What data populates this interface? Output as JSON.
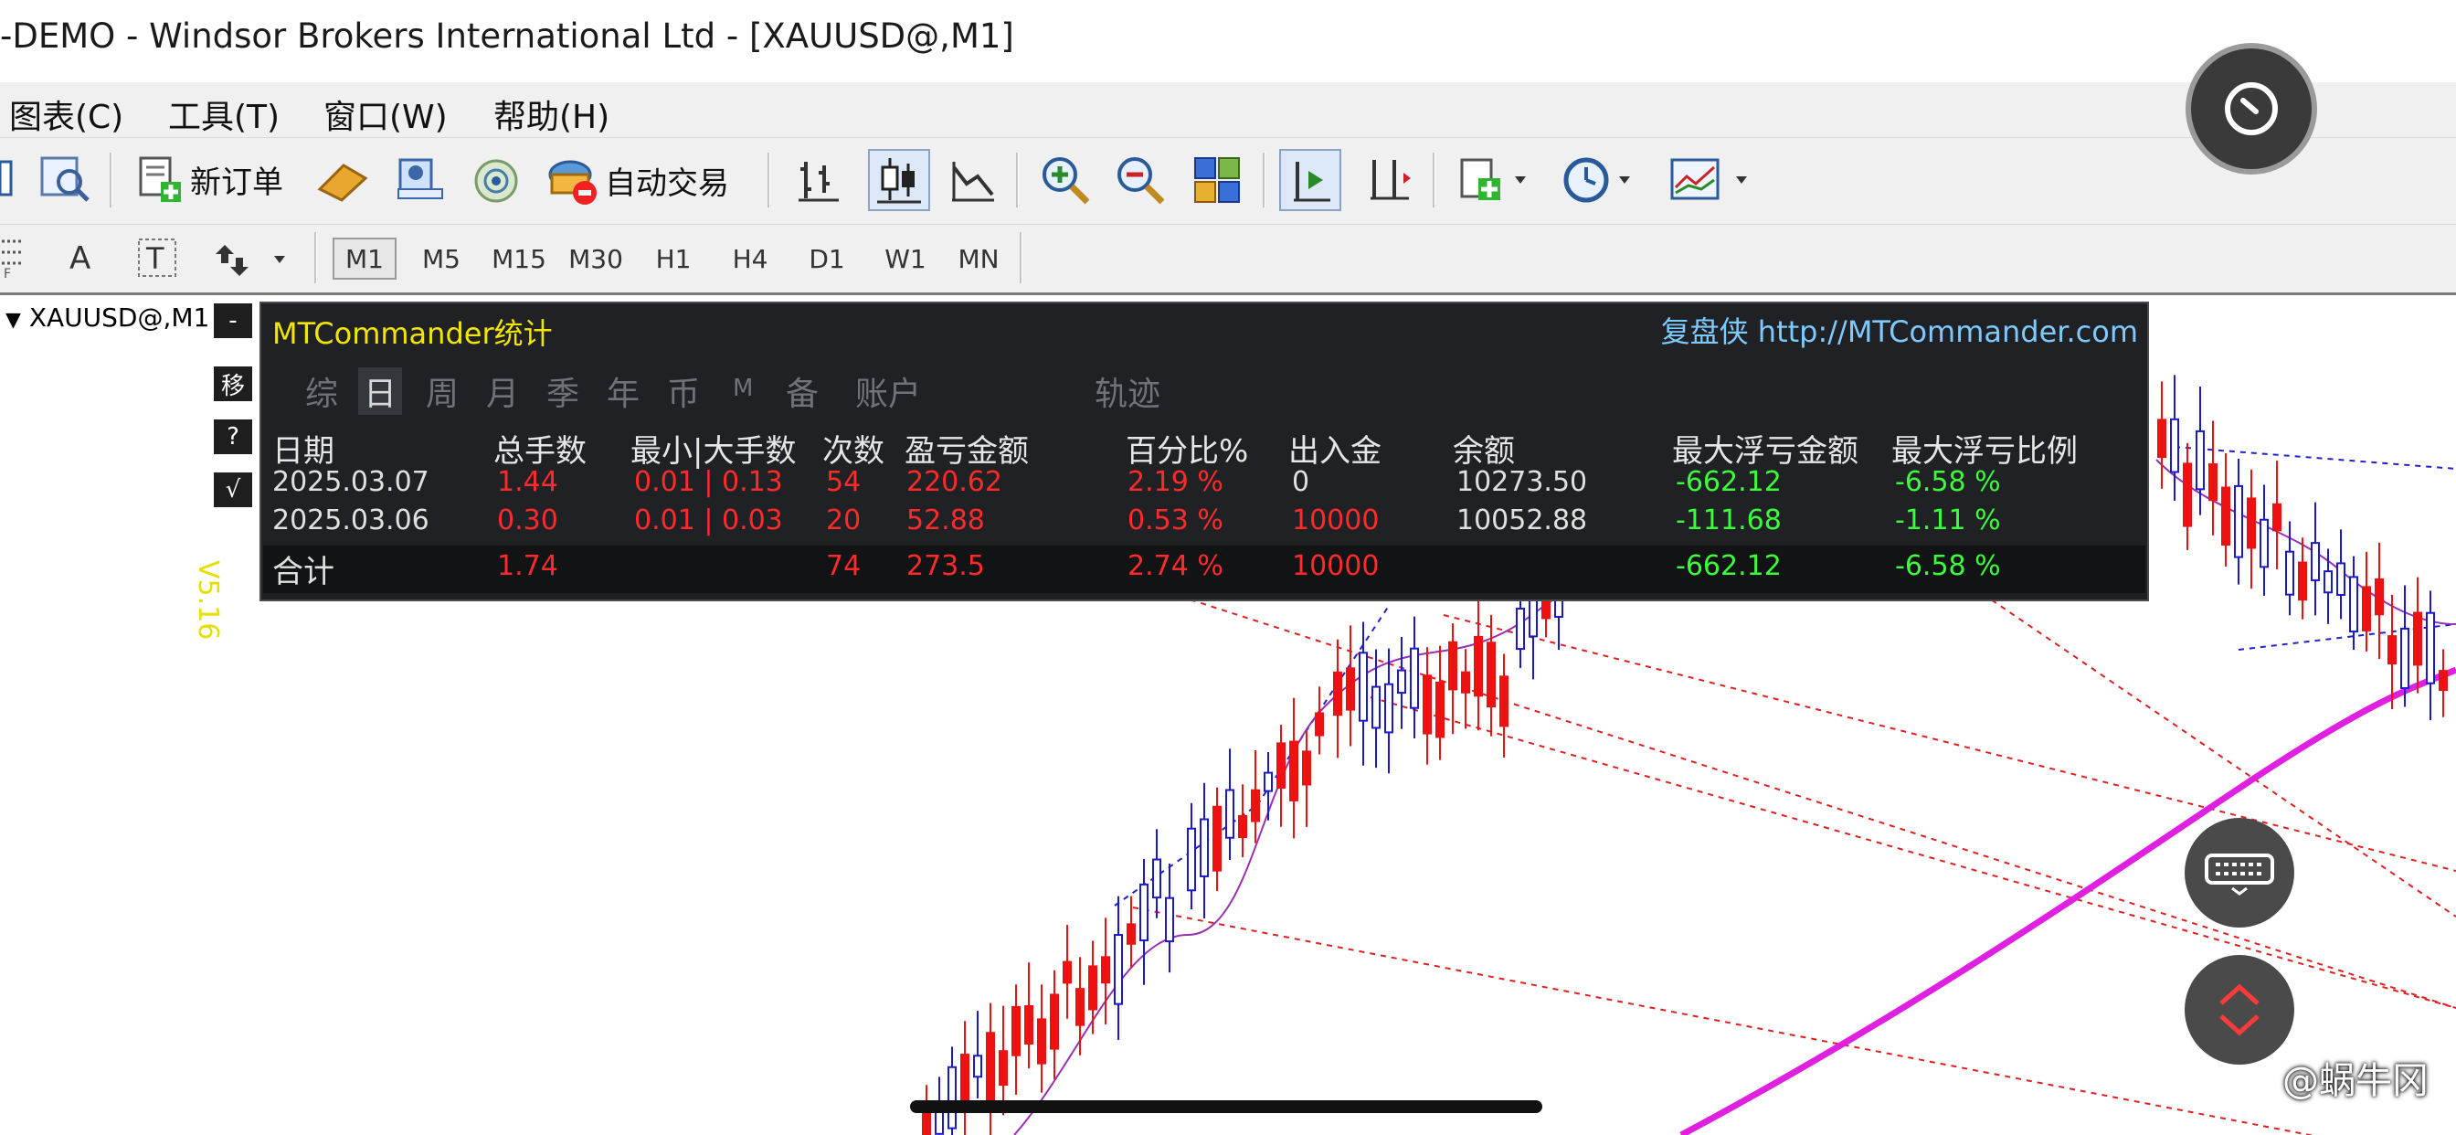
{
  "window": {
    "title": "-DEMO - Windsor Brokers International Ltd - [XAUUSD@,M1]"
  },
  "menu": [
    "图表(C)",
    "工具(T)",
    "窗口(W)",
    "帮助(H)"
  ],
  "toolbar": {
    "new_order": "新订单",
    "auto_trading": "自动交易"
  },
  "timeframes": [
    "M1",
    "M5",
    "M15",
    "M30",
    "H1",
    "H4",
    "D1",
    "W1",
    "MN"
  ],
  "timeframe_active": "M1",
  "chart": {
    "symbol": "XAUUSD@,M1",
    "side_buttons": [
      "-",
      "移",
      "?",
      "√"
    ],
    "version_label": "V5.16"
  },
  "stats": {
    "title": "MTCommander统计",
    "link": "复盘侠 http://MTCommander.com",
    "tabs": [
      "综",
      "日",
      "周",
      "月",
      "季",
      "年",
      "币",
      "M",
      "备",
      "账户",
      "轨迹"
    ],
    "active_tab": "日",
    "headers": [
      "日期",
      "总手数",
      "最小|大手数",
      "次数",
      "盈亏金额",
      "百分比%",
      "出入金",
      "余额",
      "最大浮亏金额",
      "最大浮亏比例"
    ],
    "rows": [
      [
        "2025.03.07",
        "1.44",
        "0.01 | 0.13",
        "54",
        "220.62",
        "2.19 %",
        "0",
        "10273.50",
        "-662.12",
        "-6.58 %"
      ],
      [
        "2025.03.06",
        "0.30",
        "0.01 | 0.03",
        "20",
        "52.88",
        "0.53 %",
        "10000",
        "10052.88",
        "-111.68",
        "-1.11 %"
      ]
    ],
    "total": [
      "合计",
      "1.74",
      "",
      "74",
      "273.5",
      "2.74 %",
      "10000",
      "",
      "-662.12",
      "-6.58 %"
    ]
  },
  "watermark": "@蜗牛冈",
  "colors": {
    "panel_bg": "#1f2124",
    "profit_red": "#ff2a2a",
    "loss_green": "#3cff3c",
    "title_yellow": "#f2e600",
    "ma_magenta": "#e020e0",
    "candle_up": "#1a1acc",
    "candle_down": "#ee1111"
  }
}
